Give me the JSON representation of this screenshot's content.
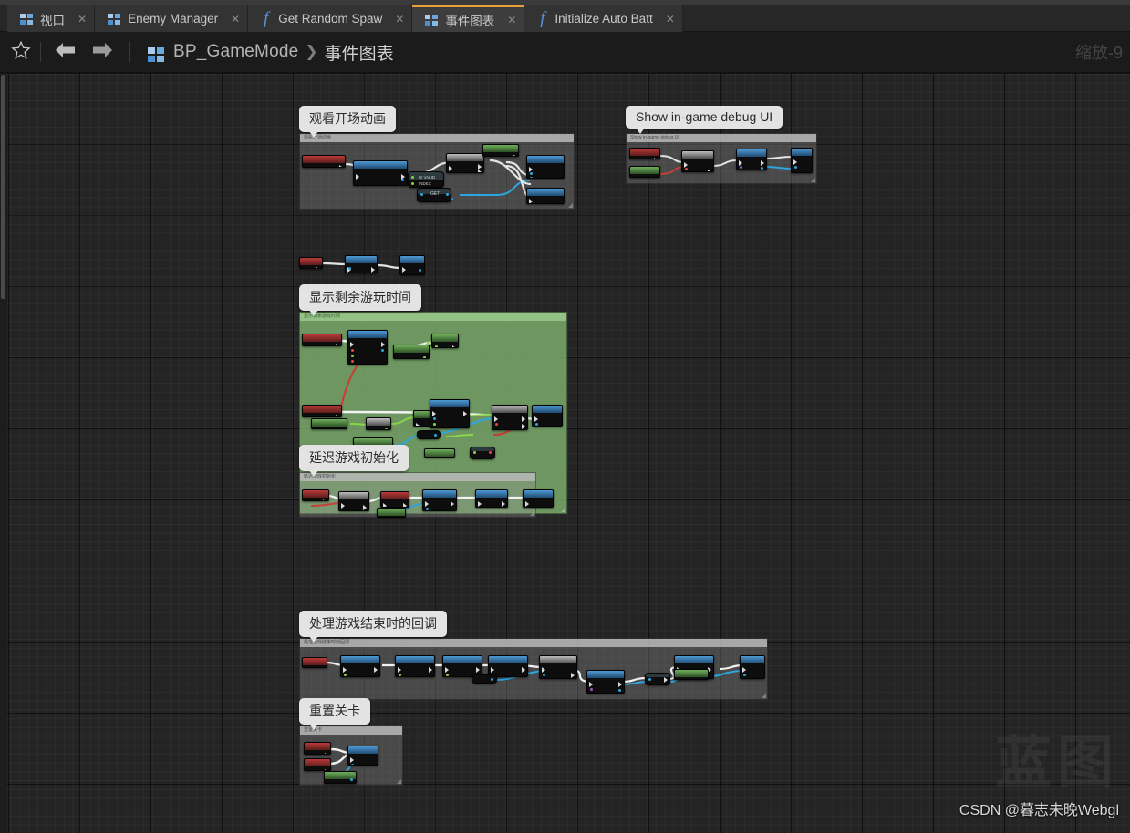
{
  "window": {
    "zoom_label": "缩放-9"
  },
  "tabs": [
    {
      "label": "视口",
      "icon": "blueprint-grid-icon",
      "active": false,
      "close": "✕"
    },
    {
      "label": "Enemy Manager",
      "icon": "blueprint-grid-icon",
      "active": false,
      "close": "✕"
    },
    {
      "label": "Get Random Spaw",
      "icon": "function-fx-icon",
      "active": false,
      "close": "✕"
    },
    {
      "label": "事件图表",
      "icon": "blueprint-grid-icon",
      "active": true,
      "close": "✕"
    },
    {
      "label": "Initialize Auto Batt",
      "icon": "function-fx-icon",
      "active": false,
      "close": "✕"
    }
  ],
  "toolbar": {
    "favorite_icon": "star-icon",
    "back_icon": "arrow-left-icon",
    "forward_icon": "arrow-right-icon",
    "breadcrumb_icon": "blueprint-grid-icon",
    "breadcrumb_root": "BP_GameMode",
    "breadcrumb_separator": "❯",
    "breadcrumb_current": "事件图表"
  },
  "comments": [
    {
      "id": "c1",
      "bubble": "观看开场动画",
      "header": "观看开场动画",
      "color": "gray"
    },
    {
      "id": "c2",
      "bubble": "Show in-game debug UI",
      "header": "Show in-game debug UI",
      "color": "gray"
    },
    {
      "id": "c3",
      "bubble": "显示剩余游玩时间",
      "header": "显示剩余游玩时间",
      "color": "green"
    },
    {
      "id": "c4",
      "bubble": "延迟游戏初始化",
      "header": "延迟游戏初始化",
      "color": "gray"
    },
    {
      "id": "c5",
      "bubble": "处理游戏结束时的回调",
      "header": "处理游戏结束时的回调",
      "color": "gray"
    },
    {
      "id": "c6",
      "bubble": "重置关卡",
      "header": "重置关卡",
      "color": "gray"
    }
  ],
  "node_labels": {
    "is_valid": "IS VALID",
    "index": "INDEX",
    "get": "GET"
  },
  "watermark": {
    "credit": "CSDN @暮志未晚Webgl",
    "logo": "蓝图"
  },
  "colors": {
    "accent_tab": "#e8a03a",
    "exec_wire": "#e3e3e3",
    "object_wire": "#2ba6e0",
    "float_wire": "#8bd34a",
    "bool_wire": "#e04a3e",
    "comment_green": "#7eb06e",
    "canvas_bg": "#242424"
  }
}
